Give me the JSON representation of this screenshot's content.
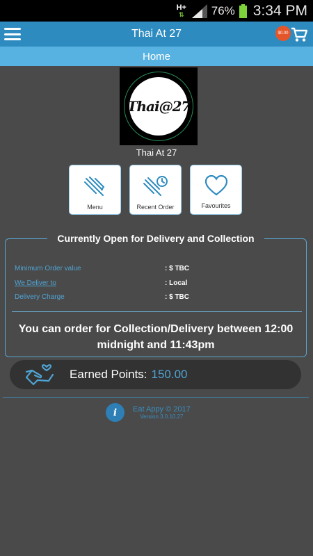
{
  "status_bar": {
    "network": "H+",
    "battery": "76%",
    "time": "3:34 PM"
  },
  "header": {
    "title": "Thai At 27",
    "cart_total": "$0.00"
  },
  "subheader": {
    "title": "Home"
  },
  "restaurant": {
    "logo_text": "Thai@27",
    "name": "Thai At 27"
  },
  "tiles": [
    {
      "label": "Menu",
      "icon": "fork-knife-icon"
    },
    {
      "label": "Recent Order",
      "icon": "recent-order-icon"
    },
    {
      "label": "Favourites",
      "icon": "heart-icon"
    }
  ],
  "info": {
    "heading": "Currently Open for Delivery and Collection",
    "rows": [
      {
        "key": "Minimum Order value",
        "value": ": $ TBC"
      },
      {
        "key": "We Deliver to",
        "value": ": Local"
      },
      {
        "key": "Delivery Charge",
        "value": ": $ TBC"
      }
    ],
    "order_window": "You can order for Collection/Delivery between 12:00 midnight and 11:43pm"
  },
  "points": {
    "label": "Earned Points:",
    "value": "150.00"
  },
  "footer": {
    "copyright": "Eat Appy © 2017",
    "version": "Version 3.0.10.27"
  },
  "colors": {
    "primary": "#2e8bc0",
    "subheader": "#58b2e1",
    "accent": "#4fa4d4",
    "badge": "#e4562a",
    "background": "#4a4a4a"
  }
}
